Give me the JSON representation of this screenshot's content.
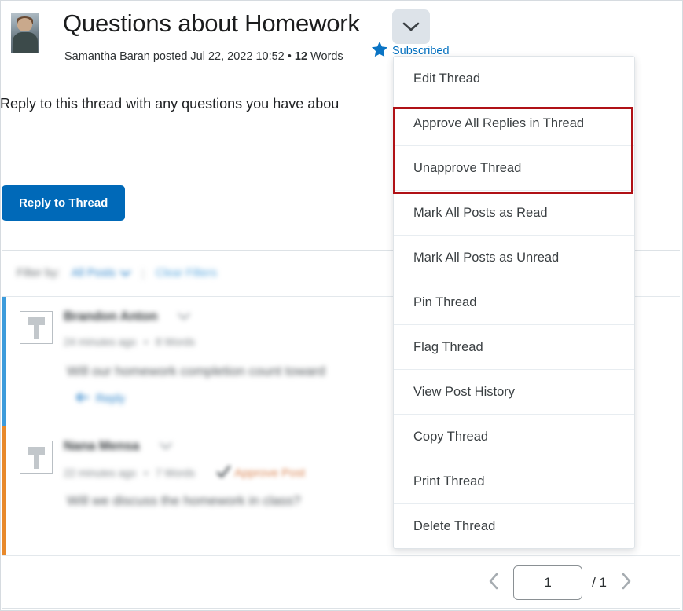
{
  "thread": {
    "title": "Questions about Homework",
    "meta_author_prefix": "Samantha Baran posted Jul 22, 2022 10:52 • ",
    "meta_word_count": "12",
    "meta_word_suffix": " Words",
    "subscribed_label": "Subscribed",
    "body_text": "Reply to this thread with any questions you have abou",
    "reply_button": "Reply to Thread"
  },
  "icons": {
    "chevron_down": "chevron-down-icon",
    "star": "star-icon",
    "subscribe_star": "star-filled-icon",
    "prev_page": "chevron-left-icon",
    "next_page": "chevron-right-icon"
  },
  "filter_bar": {
    "label": "Filter by:",
    "dropdown_value": "All Posts",
    "separator": "|",
    "clear_label": "Clear Filters"
  },
  "posts": [
    {
      "author": "Brandon Anton",
      "time": "24 minutes ago",
      "separator": "•",
      "words": "8 Words",
      "text": "Will our homework completion count toward",
      "reply_label": "Reply",
      "state": "unread",
      "approve_label": ""
    },
    {
      "author": "Nana Mensa",
      "time": "22 minutes ago",
      "separator": "•",
      "words": "7 Words",
      "text": "Will we discuss the homework in class?",
      "reply_label": "",
      "state": "pending",
      "approve_label": "Approve Post"
    }
  ],
  "pagination": {
    "current_page": "1",
    "total_pages": "/ 1",
    "prev_title": "Previous page",
    "next_title": "Next page"
  },
  "dropdown": {
    "items": [
      {
        "label": "Edit Thread"
      },
      {
        "label": "Approve All Replies in Thread"
      },
      {
        "label": "Unapprove Thread"
      },
      {
        "label": "Mark All Posts as Read"
      },
      {
        "label": "Mark All Posts as Unread"
      },
      {
        "label": "Pin Thread"
      },
      {
        "label": "Flag Thread"
      },
      {
        "label": "View Post History"
      },
      {
        "label": "Copy Thread"
      },
      {
        "label": "Print Thread"
      },
      {
        "label": "Delete Thread"
      }
    ]
  },
  "colors": {
    "primary_blue": "#0069b8",
    "link_blue": "#006fbf",
    "highlight_red": "#b01116",
    "unread_accent": "#3d9bdb",
    "pending_accent": "#e8892b",
    "approve_orange": "#d98452"
  }
}
